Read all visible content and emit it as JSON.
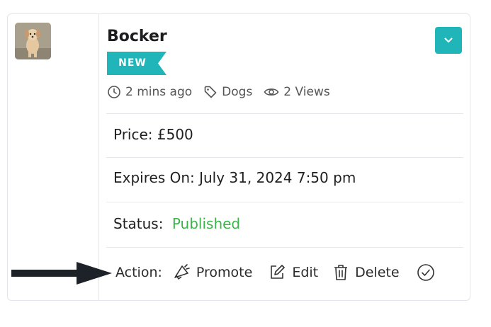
{
  "listing": {
    "title": "Bocker",
    "badge": "NEW",
    "meta": {
      "time": "2 mins ago",
      "category": "Dogs",
      "views": "2 Views"
    },
    "price": "Price: £500",
    "expires": "Expires On: July 31, 2024 7:50 pm",
    "status_label": "Status:",
    "status_value": "Published",
    "actions": {
      "label": "Action:",
      "promote": "Promote",
      "edit": "Edit",
      "delete": "Delete"
    }
  },
  "colors": {
    "accent": "#1fb5b9",
    "status_published": "#3bb54a"
  },
  "icons": [
    "chevron-down-icon",
    "clock-icon",
    "tag-icon",
    "eye-icon",
    "megaphone-icon",
    "edit-icon",
    "trash-icon",
    "check-circle-icon",
    "arrow-right-icon"
  ]
}
